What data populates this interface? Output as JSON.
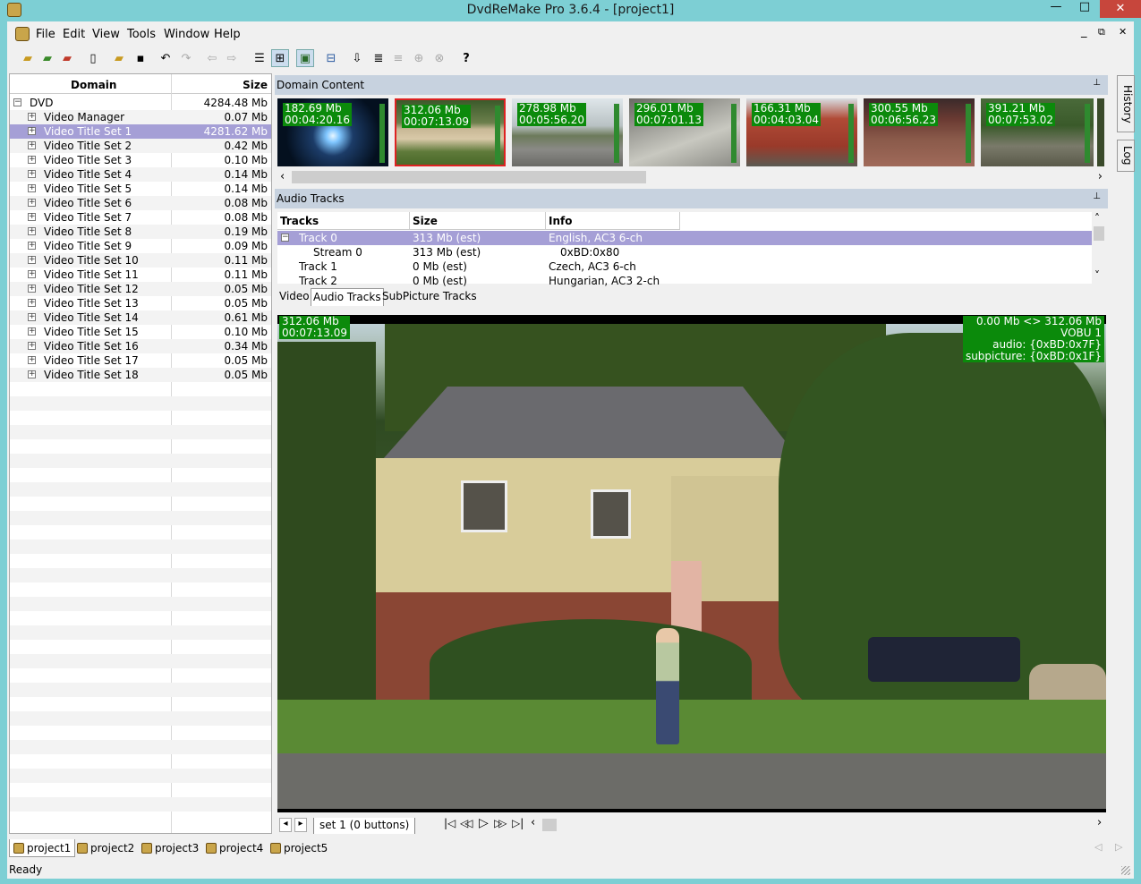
{
  "window": {
    "title": "DvdReMake Pro 3.6.4 - [project1]",
    "min": "—",
    "max": "□",
    "close": "✕",
    "mdi_min": "_",
    "mdi_restore": "⧉",
    "mdi_close": "✕"
  },
  "menu": [
    "File",
    "Edit",
    "View",
    "Tools",
    "Window",
    "Help"
  ],
  "tree": {
    "col_domain": "Domain",
    "col_size": "Size",
    "rows": [
      {
        "name": "DVD",
        "size": "4284.48 Mb",
        "toggle": "−"
      },
      {
        "name": "Video Manager",
        "size": "0.07 Mb",
        "toggle": "+"
      },
      {
        "name": "Video Title Set 1",
        "size": "4281.62 Mb",
        "toggle": "+"
      },
      {
        "name": "Video Title Set 2",
        "size": "0.42 Mb",
        "toggle": "+"
      },
      {
        "name": "Video Title Set 3",
        "size": "0.10 Mb",
        "toggle": "+"
      },
      {
        "name": "Video Title Set 4",
        "size": "0.14 Mb",
        "toggle": "+"
      },
      {
        "name": "Video Title Set 5",
        "size": "0.14 Mb",
        "toggle": "+"
      },
      {
        "name": "Video Title Set 6",
        "size": "0.08 Mb",
        "toggle": "+"
      },
      {
        "name": "Video Title Set 7",
        "size": "0.08 Mb",
        "toggle": "+"
      },
      {
        "name": "Video Title Set 8",
        "size": "0.19 Mb",
        "toggle": "+"
      },
      {
        "name": "Video Title Set 9",
        "size": "0.09 Mb",
        "toggle": "+"
      },
      {
        "name": "Video Title Set 10",
        "size": "0.11 Mb",
        "toggle": "+"
      },
      {
        "name": "Video Title Set 11",
        "size": "0.11 Mb",
        "toggle": "+"
      },
      {
        "name": "Video Title Set 12",
        "size": "0.05 Mb",
        "toggle": "+"
      },
      {
        "name": "Video Title Set 13",
        "size": "0.05 Mb",
        "toggle": "+"
      },
      {
        "name": "Video Title Set 14",
        "size": "0.61 Mb",
        "toggle": "+"
      },
      {
        "name": "Video Title Set 15",
        "size": "0.10 Mb",
        "toggle": "+"
      },
      {
        "name": "Video Title Set 16",
        "size": "0.34 Mb",
        "toggle": "+"
      },
      {
        "name": "Video Title Set 17",
        "size": "0.05 Mb",
        "toggle": "+"
      },
      {
        "name": "Video Title Set 18",
        "size": "0.05 Mb",
        "toggle": "+"
      }
    ]
  },
  "domain_content": {
    "header": "Domain Content",
    "pin": "⊥",
    "thumbs": [
      {
        "size": "182.69 Mb",
        "time": "00:04:20.16"
      },
      {
        "size": "312.06 Mb",
        "time": "00:07:13.09"
      },
      {
        "size": "278.98 Mb",
        "time": "00:05:56.20"
      },
      {
        "size": "296.01 Mb",
        "time": "00:07:01.13"
      },
      {
        "size": "166.31 Mb",
        "time": "00:04:03.04"
      },
      {
        "size": "300.55 Mb",
        "time": "00:06:56.23"
      },
      {
        "size": "391.21 Mb",
        "time": "00:07:53.02"
      }
    ],
    "scroll_left": "‹",
    "scroll_right": "›"
  },
  "audio": {
    "header": "Audio Tracks",
    "pin": "⊥",
    "col_tracks": "Tracks",
    "col_size": "Size",
    "col_info": "Info",
    "rows": [
      {
        "track": "Track 0",
        "size": "313 Mb (est)",
        "info": "English,  AC3 6-ch",
        "toggle": "−"
      },
      {
        "track": "Stream 0",
        "size": "313 Mb (est)",
        "info": "0xBD:0x80"
      },
      {
        "track": "Track 1",
        "size": "0 Mb (est)",
        "info": "Czech,  AC3 6-ch"
      },
      {
        "track": "Track 2",
        "size": "0 Mb (est)",
        "info": "Hungarian,  AC3 2-ch"
      }
    ],
    "scroll_up": "˄",
    "scroll_down": "˅"
  },
  "tabs": [
    "Video",
    "Audio Tracks",
    "SubPicture Tracks"
  ],
  "video": {
    "osd_left_size": "312.06 Mb",
    "osd_left_time": "00:07:13.09",
    "osd_right_range": "0.00 Mb <> 312.06 Mb",
    "osd_right_vobu": "VOBU 1",
    "osd_right_audio": "audio: {0xBD:0x7F}",
    "osd_right_subpic": "subpicture: {0xBD:0x1F}"
  },
  "nav": {
    "prev": "◂",
    "next": "▸",
    "set_tab": "set 1 (0 buttons)",
    "first": "|◁",
    "rew": "◁◁",
    "play": "▷",
    "ff": "▷▷",
    "last": "▷|",
    "scroll_left": "‹",
    "scroll_right": "›"
  },
  "projects": [
    "project1",
    "project2",
    "project3",
    "project4",
    "project5"
  ],
  "project_scroll_left": "◁",
  "project_scroll_right": "▷",
  "sidepanel": [
    "History",
    "Log"
  ],
  "status": "Ready",
  "toolbar_help": "?"
}
